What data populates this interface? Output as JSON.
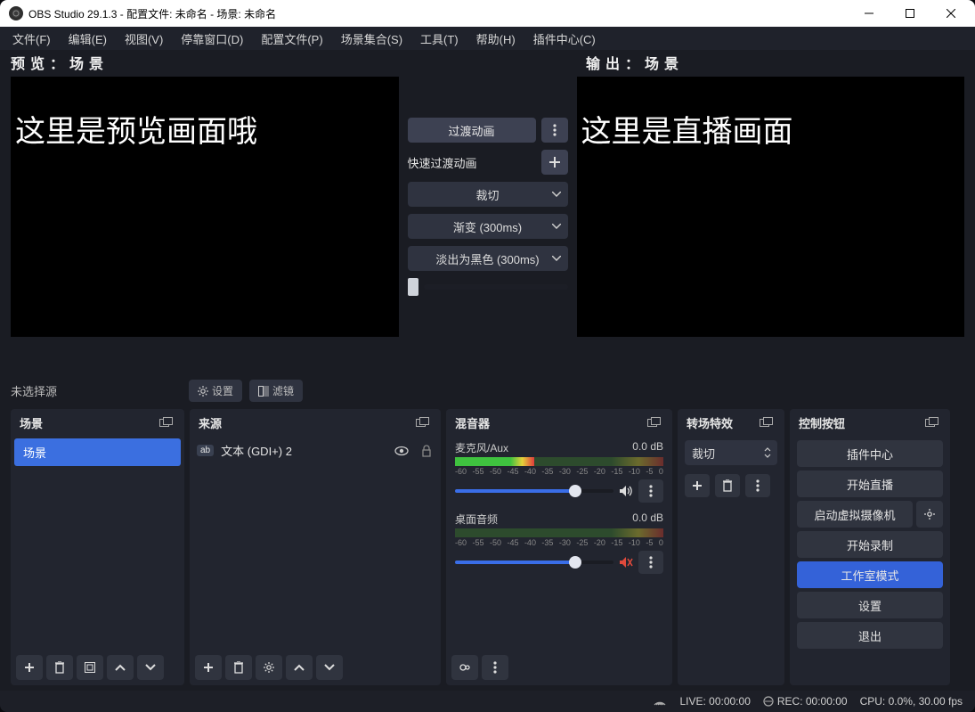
{
  "title": "OBS Studio 29.1.3 - 配置文件: 未命名 - 场景: 未命名",
  "menu": [
    "文件(F)",
    "编辑(E)",
    "视图(V)",
    "停靠窗口(D)",
    "配置文件(P)",
    "场景集合(S)",
    "工具(T)",
    "帮助(H)",
    "插件中心(C)"
  ],
  "labels": {
    "preview": "预 览 ： 场 景",
    "output": "输 出 ： 场 景"
  },
  "preview_text": "这里是预览画面哦",
  "output_text": "这里是直播画面",
  "center": {
    "transition_btn": "过渡动画",
    "quick_label": "快速过渡动画",
    "select1": "裁切",
    "select2": "渐变 (300ms)",
    "select3": "淡出为黑色 (300ms)"
  },
  "filterbar": {
    "label": "未选择源",
    "settings": "设置",
    "filters": "滤镜"
  },
  "panels": {
    "scenes": "场景",
    "sources": "来源",
    "mixer": "混音器",
    "transitions": "转场特效",
    "controls": "控制按钮"
  },
  "scenes": {
    "item1": "场景"
  },
  "sources": {
    "item1_tag": "ab",
    "item1": "文本 (GDI+) 2"
  },
  "mixer": {
    "ch1_name": "麦克风/Aux",
    "ch1_db": "0.0 dB",
    "ch2_name": "桌面音频",
    "ch2_db": "0.0 dB",
    "scale": [
      "-60",
      "-55",
      "-50",
      "-45",
      "-40",
      "-35",
      "-30",
      "-25",
      "-20",
      "-15",
      "-10",
      "-5",
      "0"
    ]
  },
  "transitions": {
    "select": "裁切"
  },
  "controls": {
    "plugin": "插件中心",
    "start_stream": "开始直播",
    "virtual_cam": "启动虚拟摄像机",
    "start_rec": "开始录制",
    "studio": "工作室模式",
    "settings": "设置",
    "exit": "退出"
  },
  "status": {
    "live": "LIVE: 00:00:00",
    "rec": "REC: 00:00:00",
    "cpu": "CPU: 0.0%, 30.00 fps"
  }
}
